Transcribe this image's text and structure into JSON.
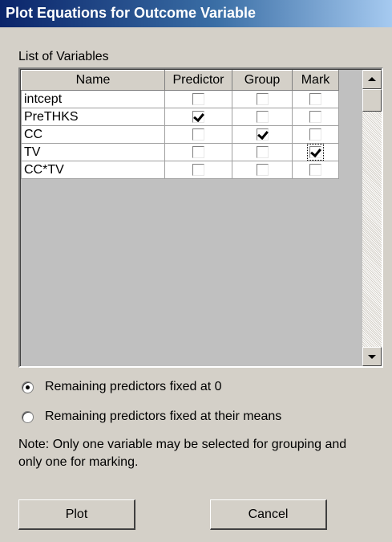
{
  "window": {
    "title": "Plot Equations for Outcome Variable"
  },
  "list_label": "List of Variables",
  "table": {
    "columns": [
      "Name",
      "Predictor",
      "Group",
      "Mark"
    ],
    "rows": [
      {
        "name": "intcept",
        "predictor": false,
        "group": false,
        "mark": false
      },
      {
        "name": "PreTHKS",
        "predictor": true,
        "group": false,
        "mark": false
      },
      {
        "name": "CC",
        "predictor": false,
        "group": true,
        "mark": false
      },
      {
        "name": "TV",
        "predictor": false,
        "group": false,
        "mark": true
      },
      {
        "name": "CC*TV",
        "predictor": false,
        "group": false,
        "mark": false
      }
    ]
  },
  "options": {
    "fixed_zero": "Remaining predictors fixed at 0",
    "fixed_means": "Remaining predictors fixed at their means",
    "selected": "fixed_zero"
  },
  "note": "Note: Only one variable may be selected for grouping and only one for marking.",
  "buttons": {
    "plot": "Plot",
    "cancel": "Cancel"
  },
  "icons": {
    "scroll_up": "arrow-up-icon",
    "scroll_down": "arrow-down-icon"
  },
  "colors": {
    "title_start": "#0a246a",
    "title_end": "#a6caf0",
    "face": "#d4d0c8"
  }
}
